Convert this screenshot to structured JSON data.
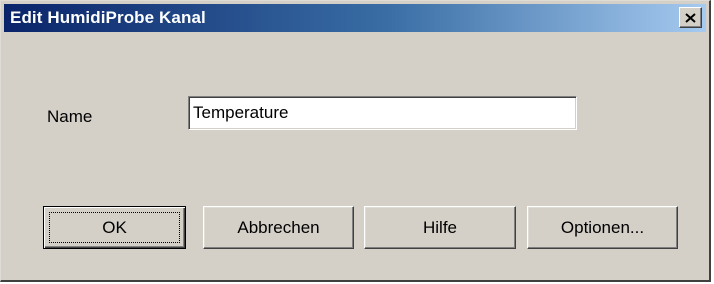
{
  "window": {
    "title": "Edit HumidiProbe Kanal",
    "close_glyph": "✕"
  },
  "form": {
    "name_label": "Name",
    "name_value": "Temperature"
  },
  "buttons": {
    "ok": "OK",
    "cancel": "Abbrechen",
    "help": "Hilfe",
    "options": "Optionen..."
  },
  "colors": {
    "face": "#d4d0c8",
    "title_start": "#0a246a",
    "title_end": "#a6caf0"
  }
}
